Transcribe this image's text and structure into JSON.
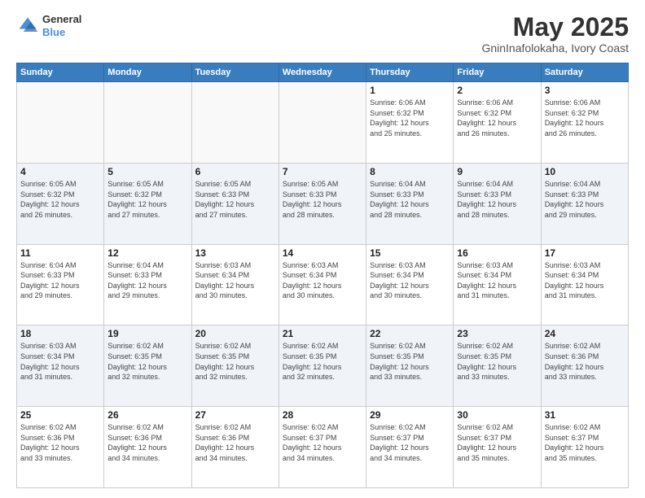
{
  "header": {
    "logo": {
      "line1": "General",
      "line2": "Blue"
    },
    "title": "May 2025",
    "location": "GninInafolokaha, Ivory Coast"
  },
  "days_of_week": [
    "Sunday",
    "Monday",
    "Tuesday",
    "Wednesday",
    "Thursday",
    "Friday",
    "Saturday"
  ],
  "weeks": [
    [
      {
        "num": "",
        "info": "",
        "empty": true
      },
      {
        "num": "",
        "info": "",
        "empty": true
      },
      {
        "num": "",
        "info": "",
        "empty": true
      },
      {
        "num": "",
        "info": "",
        "empty": true
      },
      {
        "num": "1",
        "info": "Sunrise: 6:06 AM\nSunset: 6:32 PM\nDaylight: 12 hours\nand 25 minutes.",
        "empty": false
      },
      {
        "num": "2",
        "info": "Sunrise: 6:06 AM\nSunset: 6:32 PM\nDaylight: 12 hours\nand 26 minutes.",
        "empty": false
      },
      {
        "num": "3",
        "info": "Sunrise: 6:06 AM\nSunset: 6:32 PM\nDaylight: 12 hours\nand 26 minutes.",
        "empty": false
      }
    ],
    [
      {
        "num": "4",
        "info": "Sunrise: 6:05 AM\nSunset: 6:32 PM\nDaylight: 12 hours\nand 26 minutes.",
        "empty": false
      },
      {
        "num": "5",
        "info": "Sunrise: 6:05 AM\nSunset: 6:32 PM\nDaylight: 12 hours\nand 27 minutes.",
        "empty": false
      },
      {
        "num": "6",
        "info": "Sunrise: 6:05 AM\nSunset: 6:33 PM\nDaylight: 12 hours\nand 27 minutes.",
        "empty": false
      },
      {
        "num": "7",
        "info": "Sunrise: 6:05 AM\nSunset: 6:33 PM\nDaylight: 12 hours\nand 28 minutes.",
        "empty": false
      },
      {
        "num": "8",
        "info": "Sunrise: 6:04 AM\nSunset: 6:33 PM\nDaylight: 12 hours\nand 28 minutes.",
        "empty": false
      },
      {
        "num": "9",
        "info": "Sunrise: 6:04 AM\nSunset: 6:33 PM\nDaylight: 12 hours\nand 28 minutes.",
        "empty": false
      },
      {
        "num": "10",
        "info": "Sunrise: 6:04 AM\nSunset: 6:33 PM\nDaylight: 12 hours\nand 29 minutes.",
        "empty": false
      }
    ],
    [
      {
        "num": "11",
        "info": "Sunrise: 6:04 AM\nSunset: 6:33 PM\nDaylight: 12 hours\nand 29 minutes.",
        "empty": false
      },
      {
        "num": "12",
        "info": "Sunrise: 6:04 AM\nSunset: 6:33 PM\nDaylight: 12 hours\nand 29 minutes.",
        "empty": false
      },
      {
        "num": "13",
        "info": "Sunrise: 6:03 AM\nSunset: 6:34 PM\nDaylight: 12 hours\nand 30 minutes.",
        "empty": false
      },
      {
        "num": "14",
        "info": "Sunrise: 6:03 AM\nSunset: 6:34 PM\nDaylight: 12 hours\nand 30 minutes.",
        "empty": false
      },
      {
        "num": "15",
        "info": "Sunrise: 6:03 AM\nSunset: 6:34 PM\nDaylight: 12 hours\nand 30 minutes.",
        "empty": false
      },
      {
        "num": "16",
        "info": "Sunrise: 6:03 AM\nSunset: 6:34 PM\nDaylight: 12 hours\nand 31 minutes.",
        "empty": false
      },
      {
        "num": "17",
        "info": "Sunrise: 6:03 AM\nSunset: 6:34 PM\nDaylight: 12 hours\nand 31 minutes.",
        "empty": false
      }
    ],
    [
      {
        "num": "18",
        "info": "Sunrise: 6:03 AM\nSunset: 6:34 PM\nDaylight: 12 hours\nand 31 minutes.",
        "empty": false
      },
      {
        "num": "19",
        "info": "Sunrise: 6:02 AM\nSunset: 6:35 PM\nDaylight: 12 hours\nand 32 minutes.",
        "empty": false
      },
      {
        "num": "20",
        "info": "Sunrise: 6:02 AM\nSunset: 6:35 PM\nDaylight: 12 hours\nand 32 minutes.",
        "empty": false
      },
      {
        "num": "21",
        "info": "Sunrise: 6:02 AM\nSunset: 6:35 PM\nDaylight: 12 hours\nand 32 minutes.",
        "empty": false
      },
      {
        "num": "22",
        "info": "Sunrise: 6:02 AM\nSunset: 6:35 PM\nDaylight: 12 hours\nand 33 minutes.",
        "empty": false
      },
      {
        "num": "23",
        "info": "Sunrise: 6:02 AM\nSunset: 6:35 PM\nDaylight: 12 hours\nand 33 minutes.",
        "empty": false
      },
      {
        "num": "24",
        "info": "Sunrise: 6:02 AM\nSunset: 6:36 PM\nDaylight: 12 hours\nand 33 minutes.",
        "empty": false
      }
    ],
    [
      {
        "num": "25",
        "info": "Sunrise: 6:02 AM\nSunset: 6:36 PM\nDaylight: 12 hours\nand 33 minutes.",
        "empty": false
      },
      {
        "num": "26",
        "info": "Sunrise: 6:02 AM\nSunset: 6:36 PM\nDaylight: 12 hours\nand 34 minutes.",
        "empty": false
      },
      {
        "num": "27",
        "info": "Sunrise: 6:02 AM\nSunset: 6:36 PM\nDaylight: 12 hours\nand 34 minutes.",
        "empty": false
      },
      {
        "num": "28",
        "info": "Sunrise: 6:02 AM\nSunset: 6:37 PM\nDaylight: 12 hours\nand 34 minutes.",
        "empty": false
      },
      {
        "num": "29",
        "info": "Sunrise: 6:02 AM\nSunset: 6:37 PM\nDaylight: 12 hours\nand 34 minutes.",
        "empty": false
      },
      {
        "num": "30",
        "info": "Sunrise: 6:02 AM\nSunset: 6:37 PM\nDaylight: 12 hours\nand 35 minutes.",
        "empty": false
      },
      {
        "num": "31",
        "info": "Sunrise: 6:02 AM\nSunset: 6:37 PM\nDaylight: 12 hours\nand 35 minutes.",
        "empty": false
      }
    ]
  ]
}
